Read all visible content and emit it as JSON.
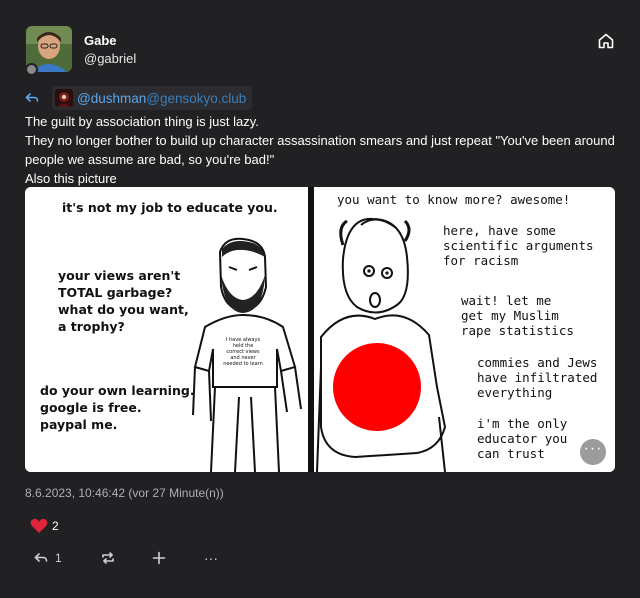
{
  "author": {
    "display_name": "Gabe",
    "handle": "@gabriel",
    "avatar_icon": "user-avatar"
  },
  "header": {
    "home_icon": "home-icon"
  },
  "reply_to": {
    "icon": "reply-icon",
    "name": "@dushman",
    "host": "@gensokyo.club"
  },
  "post": {
    "lines": [
      "The guilt by association thing is just lazy.",
      "They no longer bother to build up character assassination smears and just repeat \"You've been around people we assume are bad, so you're bad!\"",
      "Also this picture"
    ]
  },
  "media": {
    "left_panel": {
      "title": "it's not my job to educate you.",
      "speech_1": [
        "your views aren't",
        "TOTAL garbage?",
        "what do you want,",
        "a trophy?"
      ],
      "speech_2": [
        "do your own learning.",
        "google is free.",
        "paypal me."
      ],
      "shirt": [
        "I have always",
        "held the",
        "correct views",
        "and never",
        "needed to learn"
      ]
    },
    "right_panel": {
      "title": "you want to know more? awesome!",
      "speech_1": [
        "here, have some",
        "scientific arguments",
        "for racism"
      ],
      "speech_2": [
        "wait! let me",
        "get my Muslim",
        "rape statistics"
      ],
      "speech_3": [
        "commies and Jews",
        "have infiltrated",
        "everything"
      ],
      "speech_4": [
        "i'm the only",
        "educator you",
        "can trust"
      ]
    },
    "redaction_color": "#ff0000",
    "menu_label": "···"
  },
  "timestamp": "8.6.2023, 10:46:42 (vor 27 Minute(n))",
  "reactions": {
    "heart_count": "2",
    "heart_color": "#e0243b"
  },
  "actions": {
    "reply_count": "1",
    "boost_icon": "repeat-icon",
    "react_icon": "plus-icon",
    "more_label": "···"
  }
}
